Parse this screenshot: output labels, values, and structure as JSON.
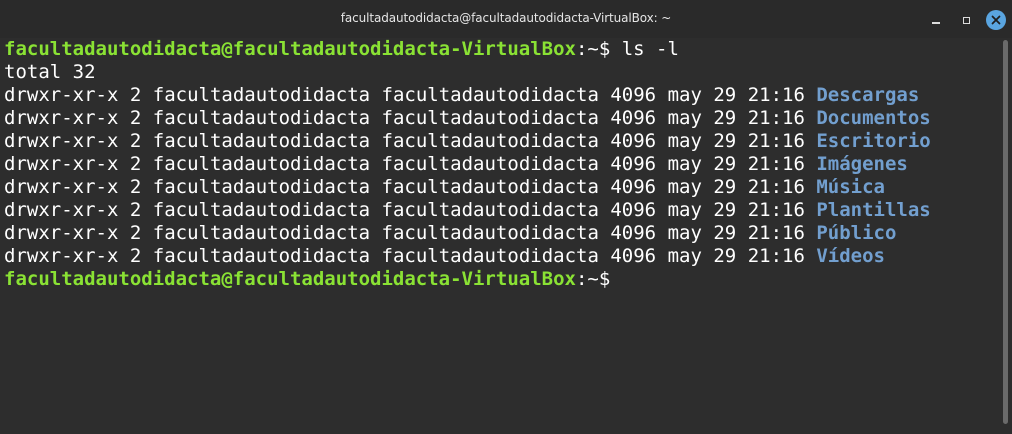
{
  "window": {
    "title": "facultadautodidacta@facultadautodidacta-VirtualBox: ~"
  },
  "icons": {
    "minimize": "minimize-icon",
    "maximize": "maximize-icon",
    "close": "close-icon"
  },
  "colors": {
    "prompt": "#8ae234",
    "directory": "#729fcf",
    "close_button": "#5aa5e0",
    "background": "#2d2d2d"
  },
  "terminal": {
    "prompt1": {
      "userhost": "facultadautodidacta@facultadautodidacta-VirtualBox",
      "path": ":~",
      "symbol": "$ ",
      "command": "ls -l"
    },
    "total": "total 32",
    "entries": [
      {
        "perms": "drwxr-xr-x",
        "links": "2",
        "owner": "facultadautodidacta",
        "group": "facultadautodidacta",
        "size": "4096",
        "month": "may",
        "day": "29",
        "time": "21:16",
        "name": "Descargas"
      },
      {
        "perms": "drwxr-xr-x",
        "links": "2",
        "owner": "facultadautodidacta",
        "group": "facultadautodidacta",
        "size": "4096",
        "month": "may",
        "day": "29",
        "time": "21:16",
        "name": "Documentos"
      },
      {
        "perms": "drwxr-xr-x",
        "links": "2",
        "owner": "facultadautodidacta",
        "group": "facultadautodidacta",
        "size": "4096",
        "month": "may",
        "day": "29",
        "time": "21:16",
        "name": "Escritorio"
      },
      {
        "perms": "drwxr-xr-x",
        "links": "2",
        "owner": "facultadautodidacta",
        "group": "facultadautodidacta",
        "size": "4096",
        "month": "may",
        "day": "29",
        "time": "21:16",
        "name": "Imágenes"
      },
      {
        "perms": "drwxr-xr-x",
        "links": "2",
        "owner": "facultadautodidacta",
        "group": "facultadautodidacta",
        "size": "4096",
        "month": "may",
        "day": "29",
        "time": "21:16",
        "name": "Música"
      },
      {
        "perms": "drwxr-xr-x",
        "links": "2",
        "owner": "facultadautodidacta",
        "group": "facultadautodidacta",
        "size": "4096",
        "month": "may",
        "day": "29",
        "time": "21:16",
        "name": "Plantillas"
      },
      {
        "perms": "drwxr-xr-x",
        "links": "2",
        "owner": "facultadautodidacta",
        "group": "facultadautodidacta",
        "size": "4096",
        "month": "may",
        "day": "29",
        "time": "21:16",
        "name": "Público"
      },
      {
        "perms": "drwxr-xr-x",
        "links": "2",
        "owner": "facultadautodidacta",
        "group": "facultadautodidacta",
        "size": "4096",
        "month": "may",
        "day": "29",
        "time": "21:16",
        "name": "Vídeos"
      }
    ],
    "prompt2": {
      "userhost": "facultadautodidacta@facultadautodidacta-VirtualBox",
      "path": ":~",
      "symbol": "$"
    }
  }
}
